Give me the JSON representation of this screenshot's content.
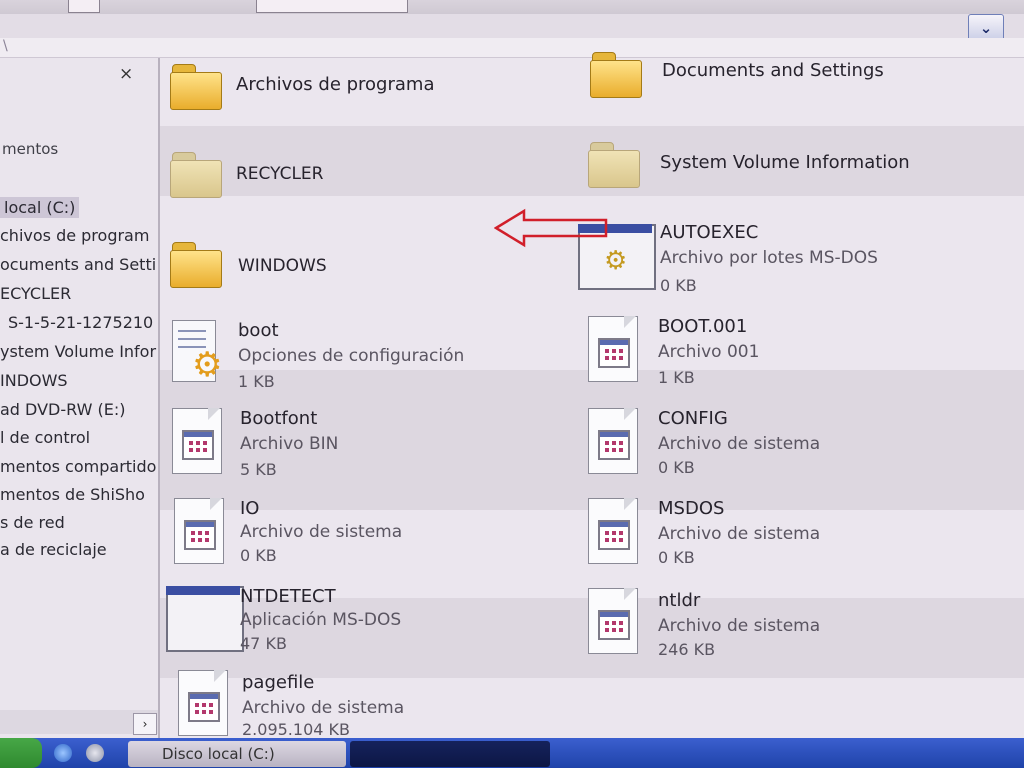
{
  "address": {
    "dropdown_icon": "chevron-down-icon",
    "path_fragment": "\\"
  },
  "sidebar": {
    "close_glyph": "×",
    "top_label": "mentos",
    "items": [
      {
        "label": "local (C:)",
        "selected": true
      },
      {
        "label": "chivos de program"
      },
      {
        "label": "ocuments and Setti"
      },
      {
        "label": "ECYCLER"
      },
      {
        "label": "S-1-5-21-1275210"
      },
      {
        "label": "ystem Volume Infor"
      },
      {
        "label": "INDOWS"
      },
      {
        "label": "ad DVD-RW (E:)"
      },
      {
        "label": "l de control"
      },
      {
        "label": "mentos compartido"
      },
      {
        "label": "mentos de ShiSho"
      },
      {
        "label": "s de red"
      },
      {
        "label": "a de reciclaje"
      }
    ],
    "scroll_right_glyph": "›"
  },
  "files": {
    "folders": [
      {
        "name": "Archivos de programa"
      },
      {
        "name": "Documents and Settings"
      },
      {
        "name": "RECYCLER"
      },
      {
        "name": "System Volume Information"
      },
      {
        "name": "WINDOWS"
      }
    ],
    "autoexec": {
      "name": "AUTOEXEC",
      "type": "Archivo por lotes MS-DOS",
      "size": "0 KB"
    },
    "boot": {
      "name": "boot",
      "type": "Opciones de configuración",
      "size": "1 KB"
    },
    "boot001": {
      "name": "BOOT.001",
      "type": "Archivo 001",
      "size": "1 KB"
    },
    "bootfont": {
      "name": "Bootfont",
      "type": "Archivo BIN",
      "size": "5 KB"
    },
    "config": {
      "name": "CONFIG",
      "type": "Archivo de sistema",
      "size": "0 KB"
    },
    "io": {
      "name": "IO",
      "type": "Archivo de sistema",
      "size": "0 KB"
    },
    "msdos": {
      "name": "MSDOS",
      "type": "Archivo de sistema",
      "size": "0 KB"
    },
    "ntdetect": {
      "name": "NTDETECT",
      "type": "Aplicación MS-DOS",
      "size": "47 KB"
    },
    "ntldr": {
      "name": "ntldr",
      "type": "Archivo de sistema",
      "size": "246 KB"
    },
    "pagefile": {
      "name": "pagefile",
      "type": "Archivo de sistema",
      "size": "2.095.104 KB"
    }
  },
  "annotation": {
    "arrow_color": "#d11f2a",
    "points_to": "RECYCLER"
  },
  "taskbar": {
    "task_disco_label": "Disco local (C:)",
    "task_2_label": ""
  },
  "colors": {
    "folder_yellow": "#e9ad2c",
    "taskbar_blue": "#1f43a9",
    "start_green": "#2f8a2f"
  }
}
